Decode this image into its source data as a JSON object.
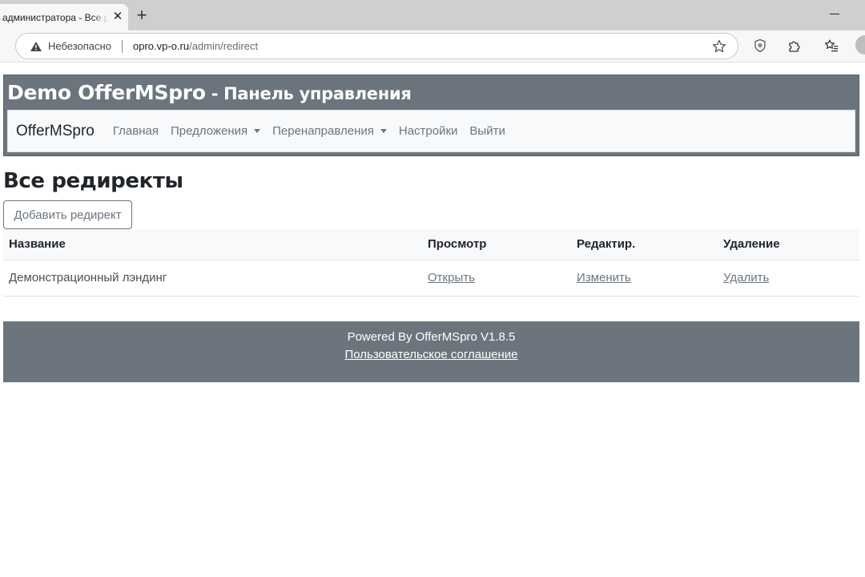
{
  "browser": {
    "tab_title": "администратора - Все редиректы",
    "new_tab_symbol": "+",
    "close_symbol": "✕",
    "security_label": "Небезопасно",
    "url_host": "opro.vp-o.ru",
    "url_path": "/admin/redirect"
  },
  "header": {
    "brand": "Demo OfferMSpro",
    "subtitle": " - Панель управления"
  },
  "nav": {
    "brand": "OfferMSpro",
    "items": [
      {
        "label": "Главная",
        "dropdown": false
      },
      {
        "label": "Предложения",
        "dropdown": true
      },
      {
        "label": "Перенаправления",
        "dropdown": true
      },
      {
        "label": "Настройки",
        "dropdown": false
      },
      {
        "label": "Выйти",
        "dropdown": false
      }
    ]
  },
  "main": {
    "title": "Все редиректы",
    "add_button": "Добавить редирект",
    "table": {
      "headers": [
        "Название",
        "Просмотр",
        "Редактир.",
        "Удаление"
      ],
      "rows": [
        {
          "name": "Демонстрационный лэндинг",
          "view": "Открыть",
          "edit": "Изменить",
          "delete": "Удалить"
        }
      ]
    }
  },
  "footer": {
    "powered": "Powered By OfferMSpro V1.8.5",
    "terms": "Пользовательское соглашение"
  },
  "colors": {
    "header_bg": "#6c757d",
    "navbar_bg": "#f8f9fa",
    "text": "#212529",
    "muted": "#6c757d"
  }
}
